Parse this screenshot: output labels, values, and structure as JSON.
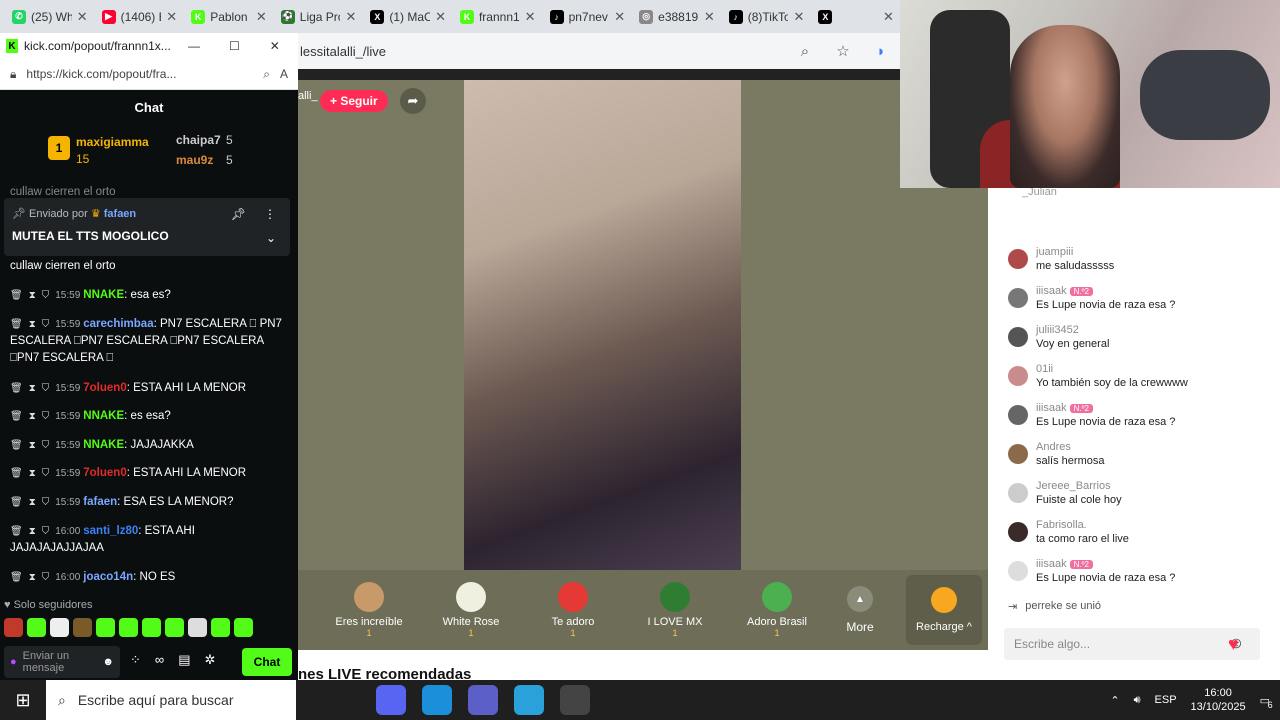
{
  "browser_tabs": [
    {
      "title": "(25) Wh",
      "color": "#25d366",
      "glyph": "✆"
    },
    {
      "title": "(1406) E",
      "color": "#ff0033",
      "glyph": "▶"
    },
    {
      "title": "Pablon",
      "color": "#53fc18",
      "glyph": "K"
    },
    {
      "title": "Liga Pro",
      "color": "#2b7a2b",
      "glyph": "⚽"
    },
    {
      "title": "(1) MaC",
      "color": "#000000",
      "glyph": "X"
    },
    {
      "title": "frannn1",
      "color": "#53fc18",
      "glyph": "K"
    },
    {
      "title": "pn7nev",
      "color": "#000000",
      "glyph": "♪"
    },
    {
      "title": "e38819",
      "color": "#888888",
      "glyph": "◎"
    },
    {
      "title": "(8)TikTo",
      "color": "#000000",
      "glyph": "♪"
    },
    {
      "title": "",
      "color": "#000000",
      "glyph": "X"
    }
  ],
  "main_browser": {
    "url_fragment": "lessitalalli_/live"
  },
  "tiktok": {
    "username_fragment": "alli_",
    "follow_label": "+ Seguir",
    "gifts": [
      {
        "name": "Eres increíble",
        "cost": "1",
        "color": "#c89a6a"
      },
      {
        "name": "White Rose",
        "cost": "1",
        "color": "#f0f0e0"
      },
      {
        "name": "Te adoro",
        "cost": "1",
        "color": "#e53935"
      },
      {
        "name": "I LOVE MX",
        "cost": "1",
        "color": "#2e7d32"
      },
      {
        "name": "Adoro Brasil",
        "cost": "1",
        "color": "#4caf50"
      }
    ],
    "more_label": "More",
    "recharge_label": "Recharge ^",
    "recommended_label": "nes LIVE recomendadas",
    "chat_top_user": "_Julian",
    "chat_messages": [
      {
        "user": "juampiii",
        "text": "me saludasssss",
        "badge": ""
      },
      {
        "user": "iiisaak",
        "text": "Es Lupe novia de raza esa ?",
        "badge": "N.º2"
      },
      {
        "user": "juliii3452",
        "text": "Voy en general",
        "badge": ""
      },
      {
        "user": "01ii",
        "text": "Yo también soy de la crewwww",
        "badge": ""
      },
      {
        "user": "iiisaak",
        "text": "Es Lupe novia de raza esa ?",
        "badge": "N.º2"
      },
      {
        "user": "Andres",
        "text": "salís hermosa",
        "badge": ""
      },
      {
        "user": "Jereee_Barrios",
        "text": "Fuiste al cole hoy",
        "badge": ""
      },
      {
        "user": "Fabrisolla.",
        "text": "ta como raro el live",
        "badge": ""
      },
      {
        "user": "iiisaak",
        "text": "Es Lupe novia de raza esa ?",
        "badge": "N.º2"
      }
    ],
    "join_text": "perreke  se unió",
    "input_placeholder": "Escribe algo..."
  },
  "kick": {
    "window_title": "kick.com/popout/frannn1x...",
    "url": "https://kick.com/popout/fra...",
    "chat_header": "Chat",
    "top_gifters": [
      {
        "name": "maxigiamma",
        "amount": "15",
        "rank": "1"
      },
      {
        "name": "chaipa7",
        "amount": "5"
      },
      {
        "name": "mau9z",
        "amount": "5"
      }
    ],
    "overflow_line": "cullaw cierren el orto",
    "pinned_by_label": "Enviado por",
    "pinned_by_user": "fafaen",
    "pinned_message": "MUTEA EL TTS MOGOLICO",
    "first_line": "cullaw cierren el orto",
    "messages": [
      {
        "time": "15:59",
        "user": "NNAKE",
        "color": "#53fc18",
        "text": ": esa es?"
      },
      {
        "time": "15:59",
        "user": "carechimbaa",
        "color": "#7aa7ff",
        "text": ": PN7 ESCALERA ⎕ PN7 ESCALERA ⎕PN7 ESCALERA ⎕PN7 ESCALERA ⎕PN7 ESCALERA ⎕"
      },
      {
        "time": "15:59",
        "user": "7oluen0",
        "color": "#e02b2b",
        "text": ": ESTA AHI LA MENOR"
      },
      {
        "time": "15:59",
        "user": "NNAKE",
        "color": "#53fc18",
        "text": ": es esa?"
      },
      {
        "time": "15:59",
        "user": "NNAKE",
        "color": "#53fc18",
        "text": ": JAJAJAKKA"
      },
      {
        "time": "15:59",
        "user": "7oluen0",
        "color": "#e02b2b",
        "text": ": ESTA AHI LA MENOR"
      },
      {
        "time": "15:59",
        "user": "fafaen",
        "color": "#7aa7ff",
        "text": ": ESA ES LA MENOR?"
      },
      {
        "time": "16:00",
        "user": "santi_lz80",
        "color": "#3b82f6",
        "text": ": ESTA AHI JAJAJAJAJJAJAA"
      },
      {
        "time": "16:00",
        "user": "joaco14n",
        "color": "#7aa7ff",
        "text": ": NO ES"
      }
    ],
    "followers_only_label": "Solo seguidores",
    "input_placeholder": "Enviar un mensaje",
    "send_label": "Chat"
  },
  "taskbar": {
    "search_placeholder": "Escribe aquí para buscar",
    "language": "ESP",
    "time": "16:00",
    "date": "13/10/2025",
    "notifications": "6"
  }
}
